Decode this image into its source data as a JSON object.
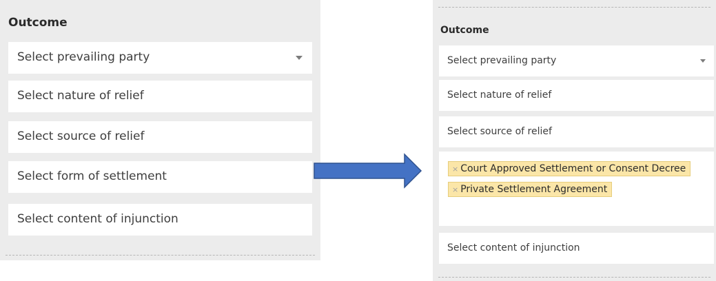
{
  "before": {
    "heading": "Outcome",
    "fields": [
      {
        "placeholder": "Select prevailing party",
        "has_dropdown": true
      },
      {
        "placeholder": "Select nature of relief"
      },
      {
        "placeholder": "Select source of relief"
      },
      {
        "placeholder": "Select form of settlement"
      },
      {
        "placeholder": "Select content of injunction"
      }
    ]
  },
  "after": {
    "heading": "Outcome",
    "fields": [
      {
        "placeholder": "Select prevailing party",
        "has_dropdown": true
      },
      {
        "placeholder": "Select nature of relief"
      },
      {
        "placeholder": "Select source of relief"
      },
      {
        "selected_tags": [
          "Court Approved Settlement or Consent Decree",
          "Private Settlement Agreement"
        ]
      },
      {
        "placeholder": "Select content of injunction"
      }
    ],
    "tag_remove_symbol": "×"
  },
  "colors": {
    "panel_bg": "#ececec",
    "field_bg": "#ffffff",
    "tag_bg": "#fbe6a8",
    "arrow_fill": "#4472c4"
  },
  "icons": [
    "chevron-down-icon",
    "remove-tag-icon",
    "right-arrow-icon"
  ]
}
